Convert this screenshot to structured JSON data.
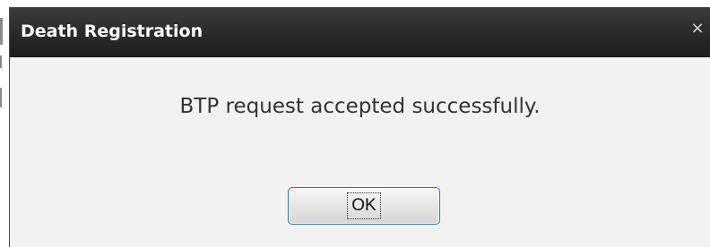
{
  "dialog": {
    "title": "Death Registration",
    "close_symbol": "×",
    "message": "BTP request accepted successfully.",
    "ok_label": "OK"
  },
  "icons": {
    "close": "close-icon"
  }
}
